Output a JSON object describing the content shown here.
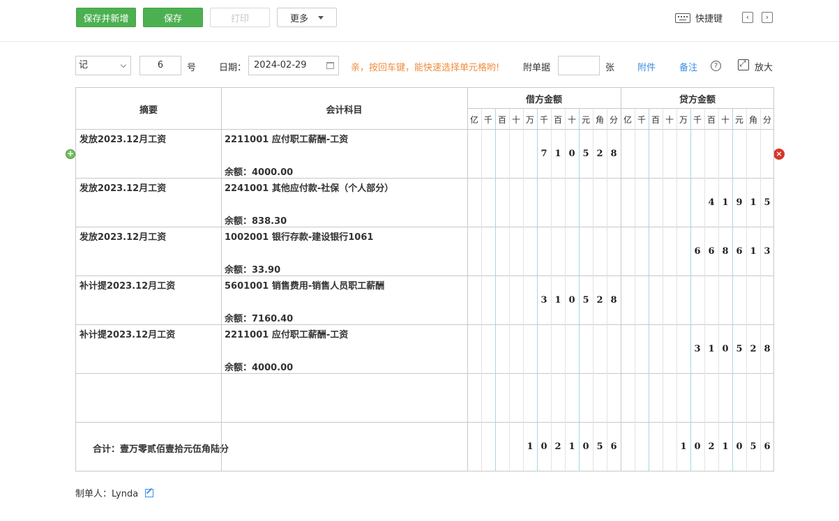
{
  "toolbar": {
    "save_new_label": "保存并新增",
    "save_label": "保存",
    "print_label": "打印",
    "more_label": "更多",
    "shortcut_label": "快捷键"
  },
  "header": {
    "voucher_type": "记",
    "voucher_number": "6",
    "number_suffix": "号",
    "date_label": "日期：",
    "date_value": "2024-02-29",
    "hint": "亲，按回车键，能快速选择单元格哟!",
    "attachment_label": "附单据",
    "attachment_count": "",
    "attachment_unit": "张",
    "attachment_link": "附件",
    "note_link": "备注",
    "expand_label": "放大"
  },
  "table": {
    "col_summary": "摘要",
    "col_subject": "会计科目",
    "col_debit": "借方金额",
    "col_credit": "贷方金额",
    "digit_headers": [
      "亿",
      "千",
      "百",
      "十",
      "万",
      "千",
      "百",
      "十",
      "元",
      "角",
      "分"
    ],
    "balance_prefix": "余额：",
    "rows": [
      {
        "summary": "发放2023.12月工资",
        "subject": "2211001 应付职工薪酬-工资",
        "balance": "余额：4000.00",
        "debit": "710528",
        "credit": ""
      },
      {
        "summary": "发放2023.12月工资",
        "subject": "2241001 其他应付款-社保（个人部分）",
        "balance": "余额：838.30",
        "debit": "",
        "credit": "41915"
      },
      {
        "summary": "发放2023.12月工资",
        "subject": "1002001 银行存款-建设银行1061",
        "balance": "余额：33.90",
        "debit": "",
        "credit": "668613"
      },
      {
        "summary": "补计提2023.12月工资",
        "subject": "5601001 销售费用-销售人员职工薪酬",
        "balance": "余额：7160.40",
        "debit": "310528",
        "credit": ""
      },
      {
        "summary": "补计提2023.12月工资",
        "subject": "2211001 应付职工薪酬-工资",
        "balance": "余额：4000.00",
        "debit": "",
        "credit": "310528"
      }
    ],
    "total_label": "合计：壹万零贰佰壹拾元伍角陆分",
    "total_debit": "1021056",
    "total_credit": "1021056"
  },
  "footer": {
    "creator": "制单人：Lynda"
  }
}
